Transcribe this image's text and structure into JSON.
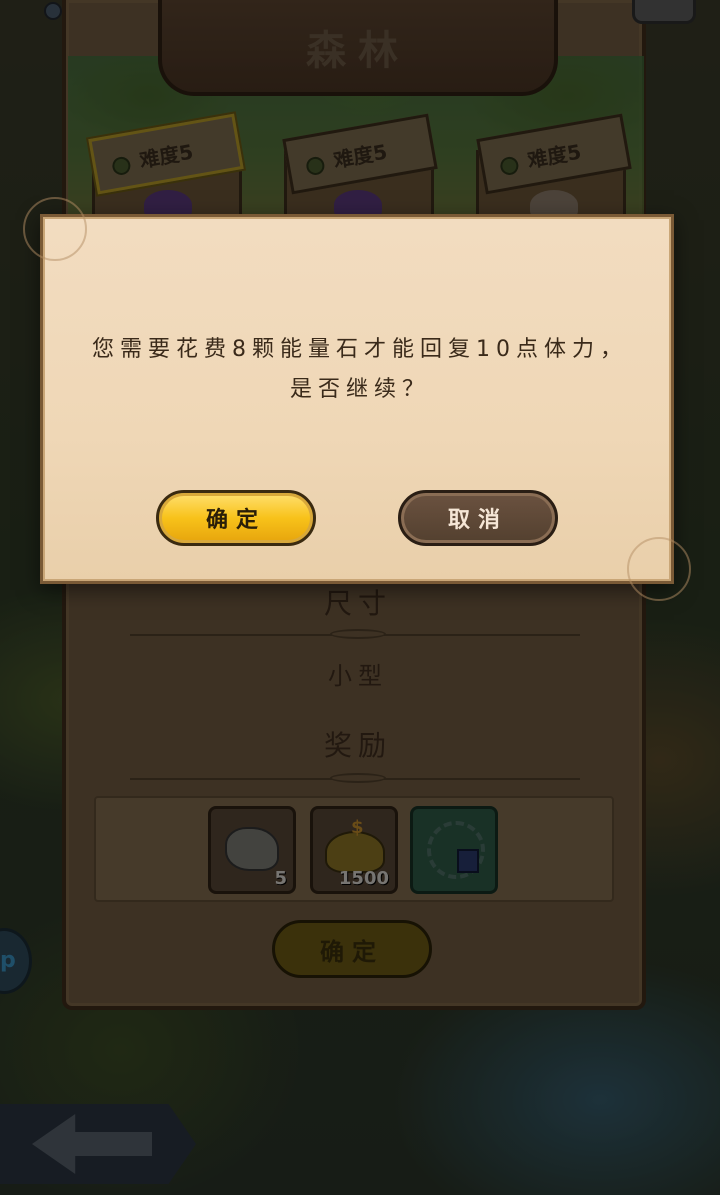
{
  "stage": {
    "title": "森林",
    "difficulties": [
      {
        "label": "难度5",
        "selected": true
      },
      {
        "label": "难度5",
        "selected": false
      },
      {
        "label": "难度5",
        "selected": false
      }
    ],
    "size_label": "尺寸",
    "size_value": "小型",
    "rewards_label": "奖励",
    "rewards": [
      {
        "icon": "ore-icon",
        "count": "5"
      },
      {
        "icon": "gold-coins-icon",
        "count": "1500"
      },
      {
        "icon": "necklace-icon",
        "count": ""
      }
    ],
    "confirm_label": "确定"
  },
  "side_badge_text": "p",
  "dialog": {
    "message": "您需要花费8颗能量石才能回复10点体力，是否继续？",
    "confirm_label": "确定",
    "cancel_label": "取消"
  },
  "colors": {
    "confirm_button": "#f8c21a",
    "cancel_button": "#53402f",
    "dialog_bg": "#f2dcc0"
  }
}
